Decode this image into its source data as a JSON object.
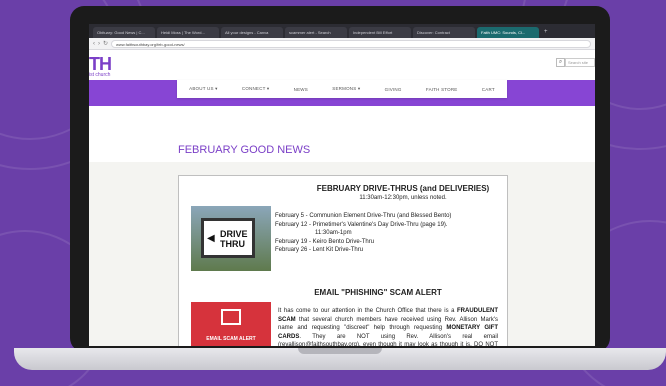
{
  "browser": {
    "tabs": [
      "Obituary: Good News | C...",
      "Heidi Moss | The Word...",
      "All your designs - Canva",
      "scammer alert - Search",
      "Independent Bill Effort",
      "Discover: Contract",
      "Faith UMC: Sounds, Cl..."
    ],
    "active_tab_index": 6,
    "new_tab_glyph": "+",
    "url": "www.faithsouthbay.org/feb-good-news/"
  },
  "site": {
    "logo_text": "TH",
    "logo_sub": "ist church",
    "search_icon": "⌕",
    "search_placeholder": "Search site",
    "nav": [
      "ABOUT US ▾",
      "CONNECT ▾",
      "NEWS",
      "SERMONS ▾",
      "GIVING",
      "FAITH STORE",
      "CART"
    ]
  },
  "page": {
    "title": "FEBRUARY GOOD NEWS",
    "drive": {
      "heading": "FEBRUARY DRIVE-THRUS (and DELIVERIES)",
      "time": "11:30am-12:30pm, unless noted.",
      "items": [
        "February 5 - Communion Element Drive-Thru (and Blessed Bento)",
        "February 12 - Primetimer's Valentine's Day Drive-Thru (page 19).",
        "11:30am-1pm",
        "February 19 - Keiro Bento Drive-Thru",
        "February 26 - Lent Kit Drive-Thru"
      ],
      "sign_text_1": "DRIVE",
      "sign_text_2": "THRU"
    },
    "scam": {
      "heading": "EMAIL \"PHISHING\" SCAM ALERT",
      "image_label": "EMAIL SCAM ALERT",
      "p1": "It has come to our attention in the Church Office that there is a",
      "p1_bold": "FRAUDULENT SCAM",
      "p1b": "that several church members have received using Rev. Allison Mark's name and requesting \"discreet\" help through requesting",
      "p1_bold2": "MONETARY GIFT CARDS",
      "p1c": ". They are NOT using Rev. Allison's real email (revallison@faithsouthbay.org), even though it may look as though it is. DO NOT RESPOND TO ANY CHURCH OFFICE EMAILS"
    }
  },
  "colors": {
    "brand_purple": "#7b3fc7",
    "band_purple": "#8745d4",
    "backdrop": "#6a3fa8",
    "alert_red": "#d6333c"
  }
}
